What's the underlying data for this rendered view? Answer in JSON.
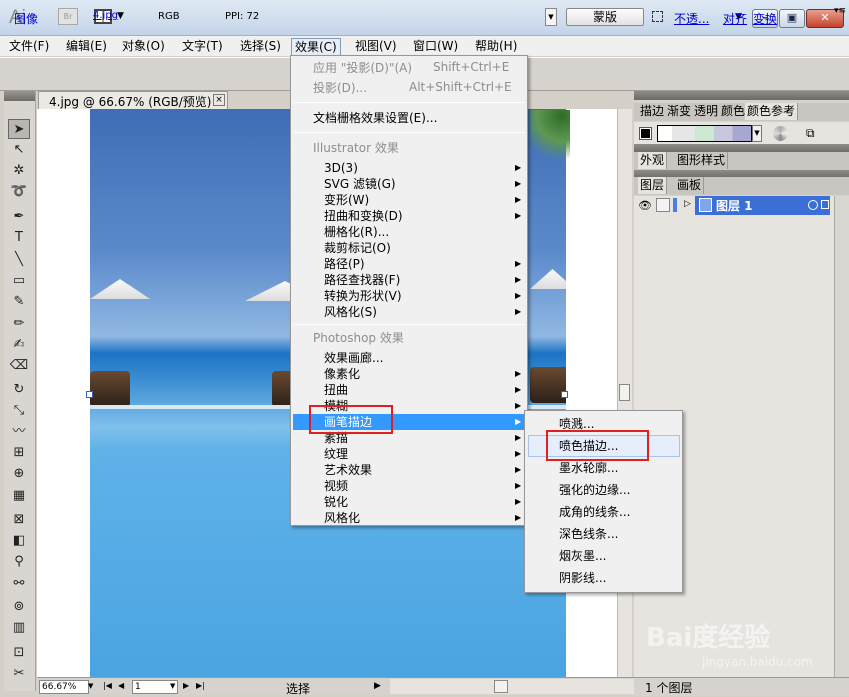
{
  "titlebar": {
    "app_logo": "Ai",
    "bridge_icon": "Br"
  },
  "menubar": {
    "items": [
      "文件(F)",
      "编辑(E)",
      "对象(O)",
      "文字(T)",
      "选择(S)",
      "效果(C)",
      "视图(V)",
      "窗口(W)",
      "帮助(H)"
    ]
  },
  "controlbar": {
    "image_label": "图像",
    "file_name": "4.jpg",
    "color_mode": "RGB",
    "ppi": "PPI: 72",
    "mask_button": "蒙版",
    "opacity_link": "不透...",
    "align_link": "对齐",
    "transform_link": "变换"
  },
  "document": {
    "tab_title": "4.jpg @ 66.67% (RGB/预览)",
    "close_glyph": "×"
  },
  "statusbar": {
    "zoom": "66.67%",
    "page": "1",
    "current_tool": "选择"
  },
  "right_panels": {
    "top_tabs": [
      "描边",
      "渐变",
      "透明",
      "颜色",
      "颜色参考"
    ],
    "mid_tabs": [
      "外观",
      "图形样式"
    ],
    "layer_tabs": [
      "图层",
      "画板"
    ],
    "layer_name": "图层 1",
    "layers_count": "1 个图层"
  },
  "effect_menu": {
    "apply_last": "应用 \"投影(D)\"(A)",
    "apply_last_shortcut": "Shift+Ctrl+E",
    "last_effect": "投影(D)...",
    "last_effect_shortcut": "Alt+Shift+Ctrl+E",
    "raster_settings": "文档栅格效果设置(E)...",
    "illustrator_header": "Illustrator 效果",
    "illustrator_items": [
      "3D(3)",
      "SVG 滤镜(G)",
      "变形(W)",
      "扭曲和变换(D)",
      "栅格化(R)...",
      "裁剪标记(O)",
      "路径(P)",
      "路径查找器(F)",
      "转换为形状(V)",
      "风格化(S)"
    ],
    "photoshop_header": "Photoshop 效果",
    "photoshop_items": [
      "效果画廊...",
      "像素化",
      "扭曲",
      "模糊",
      "画笔描边",
      "素描",
      "纹理",
      "艺术效果",
      "视频",
      "锐化",
      "风格化"
    ]
  },
  "brush_stroke_submenu": {
    "items": [
      "喷溅...",
      "喷色描边...",
      "墨水轮廓...",
      "强化的边缘...",
      "成角的线条...",
      "深色线条...",
      "烟灰墨...",
      "阴影线..."
    ]
  },
  "watermark": {
    "brand": "Bai度经验",
    "url": "jingyan.baidu.com"
  },
  "colors": {
    "highlight": "#3399ff",
    "callout": "#e02020",
    "layer_color": "#4b7be5"
  }
}
